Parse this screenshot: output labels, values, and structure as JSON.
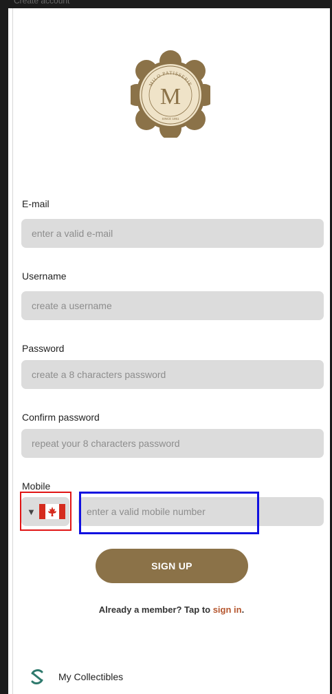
{
  "top_caption": "Create account",
  "logo": {
    "ring_text": "MILO PATISSERIE",
    "monogram": "M",
    "since": "SINCE 1951",
    "colors": {
      "badge": "#8b7248",
      "inner": "#efe3c8"
    }
  },
  "form": {
    "email": {
      "label": "E-mail",
      "placeholder": "enter a valid e-mail",
      "value": ""
    },
    "username": {
      "label": "Username",
      "placeholder": "create a username",
      "value": ""
    },
    "password": {
      "label": "Password",
      "placeholder": "create a 8 characters password",
      "value": ""
    },
    "confirm_password": {
      "label": "Confirm password",
      "placeholder": "repeat your 8 characters password",
      "value": ""
    },
    "mobile": {
      "label": "Mobile",
      "placeholder": "enter a valid mobile number",
      "value": "",
      "country": {
        "flag": "canada-flag-icon",
        "caret": "▼"
      }
    }
  },
  "signup_button": "SIGN UP",
  "already_member": {
    "prefix": "Already a member? Tap to ",
    "link": "sign in",
    "suffix": "."
  },
  "bottom_bar": {
    "label": "My Collectibles",
    "icon": "collectibles-icon"
  },
  "colors": {
    "accent": "#8b7248",
    "link": "#b5562e",
    "field_bg": "#dcdcdc",
    "highlight_red": "#e01414",
    "highlight_blue": "#1010e0"
  }
}
